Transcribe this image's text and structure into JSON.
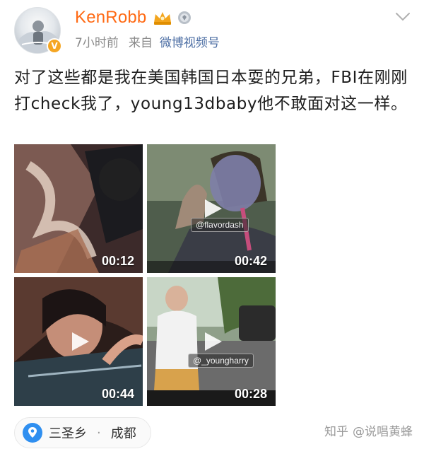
{
  "post": {
    "author": {
      "name": "KenRobb",
      "avatar": "avatar",
      "badges": [
        "crown-badge-icon",
        "level-badge-icon",
        "verified-badge-icon"
      ]
    },
    "time": "7小时前",
    "source_prefix": "来自",
    "source": "微博视频号",
    "text": "对了这些都是我在美国韩国日本耍的兄弟，FBI在刚刚打check我了，young13dbaby他不敢面对这一样。",
    "videos": [
      {
        "duration": "00:12",
        "tag": ""
      },
      {
        "duration": "00:42",
        "tag": "@flavordash"
      },
      {
        "duration": "00:44",
        "tag": ""
      },
      {
        "duration": "00:28",
        "tag": "@_youngharry"
      }
    ],
    "location": {
      "place": "三圣乡",
      "separator": "·",
      "city": "成都"
    }
  },
  "watermark": {
    "site": "知乎",
    "author": "@说唱黄蜂"
  },
  "colors": {
    "username": "#ff6a14",
    "source_link": "#4b6da3",
    "location_pin": "#2f8ff0"
  }
}
